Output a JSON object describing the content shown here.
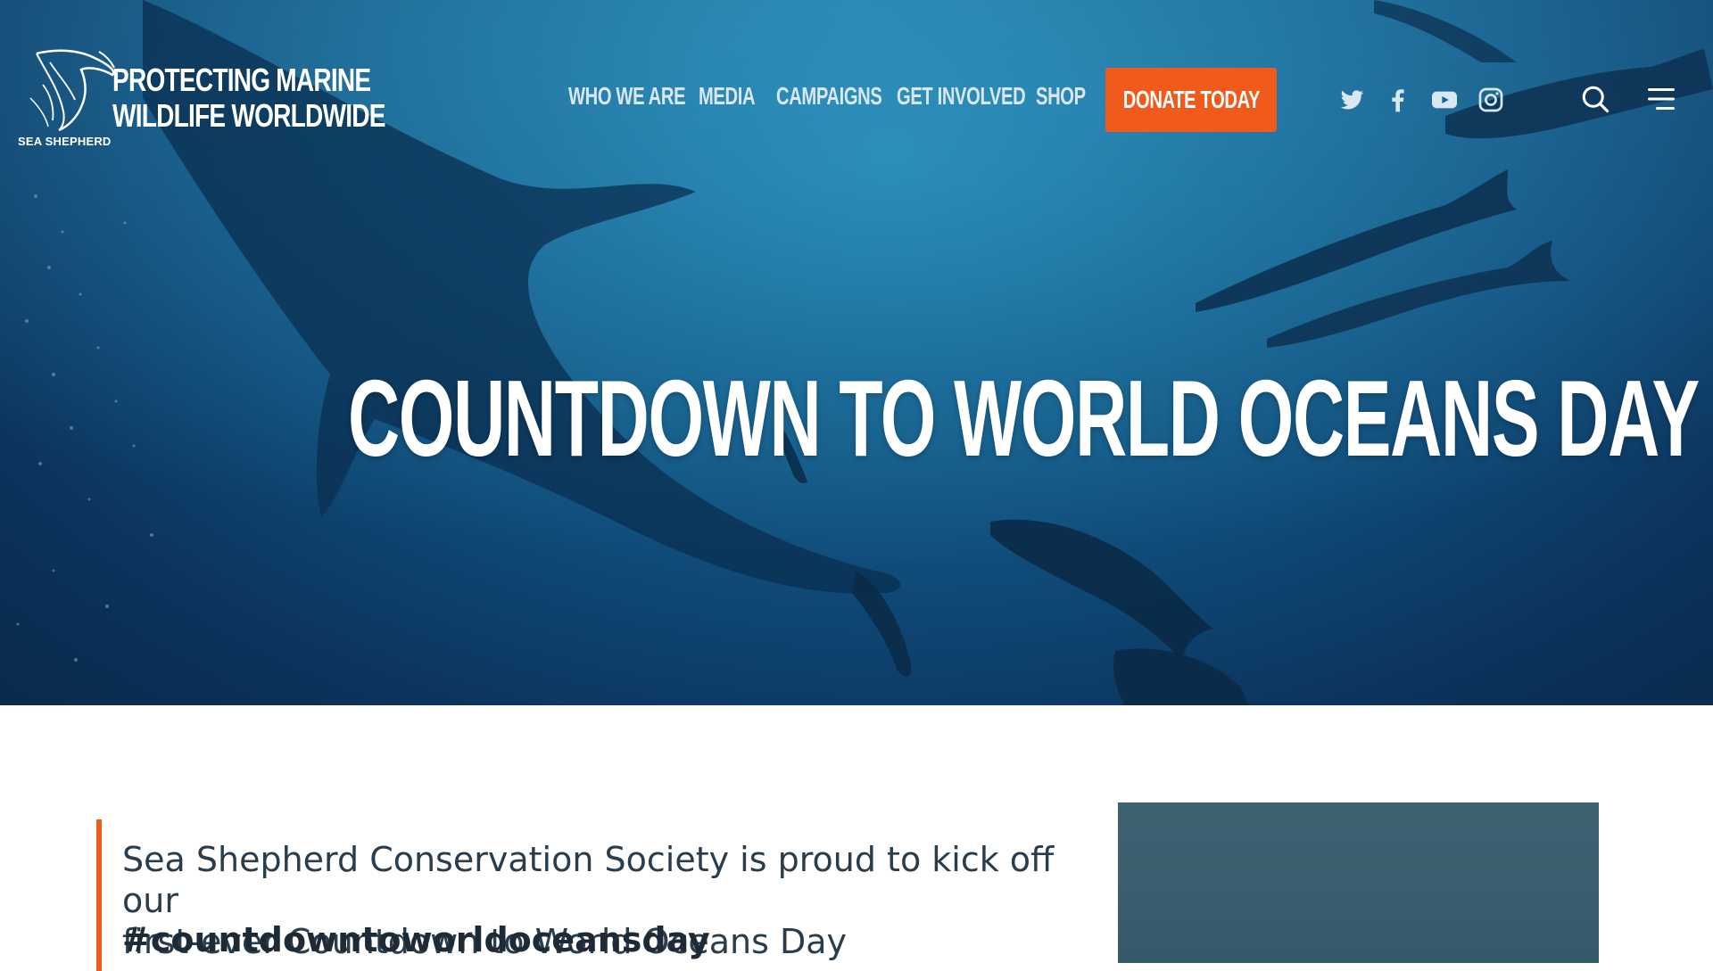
{
  "header": {
    "logo": {
      "org_name": "SEA SHEPHERD",
      "tagline_line1": "PROTECTING MARINE",
      "tagline_line2": "WILDLIFE WORLDWIDE"
    },
    "nav": [
      {
        "label": "WHO WE ARE"
      },
      {
        "label": "MEDIA"
      },
      {
        "label": "CAMPAIGNS"
      },
      {
        "label": "GET INVOLVED"
      },
      {
        "label": "SHOP"
      }
    ],
    "donate_label": "DONATE TODAY",
    "social_icons": [
      "twitter-icon",
      "facebook-icon",
      "youtube-icon",
      "instagram-icon"
    ],
    "tools": [
      "search-icon",
      "menu-icon"
    ]
  },
  "hero": {
    "title": "COUNTDOWN TO WORLD OCEANS DAY"
  },
  "content": {
    "intro_line1": "Sea Shepherd Conservation Society is proud to kick off our",
    "intro_line2": "first-ever Countdown to World Oceans Day",
    "hashtag": "#countdowntoworldoceansday"
  },
  "colors": {
    "accent": "#f05a1a",
    "hero_deep": "#0b335b",
    "hero_light": "#1f7fae",
    "text_dark": "#2a3d4d"
  }
}
